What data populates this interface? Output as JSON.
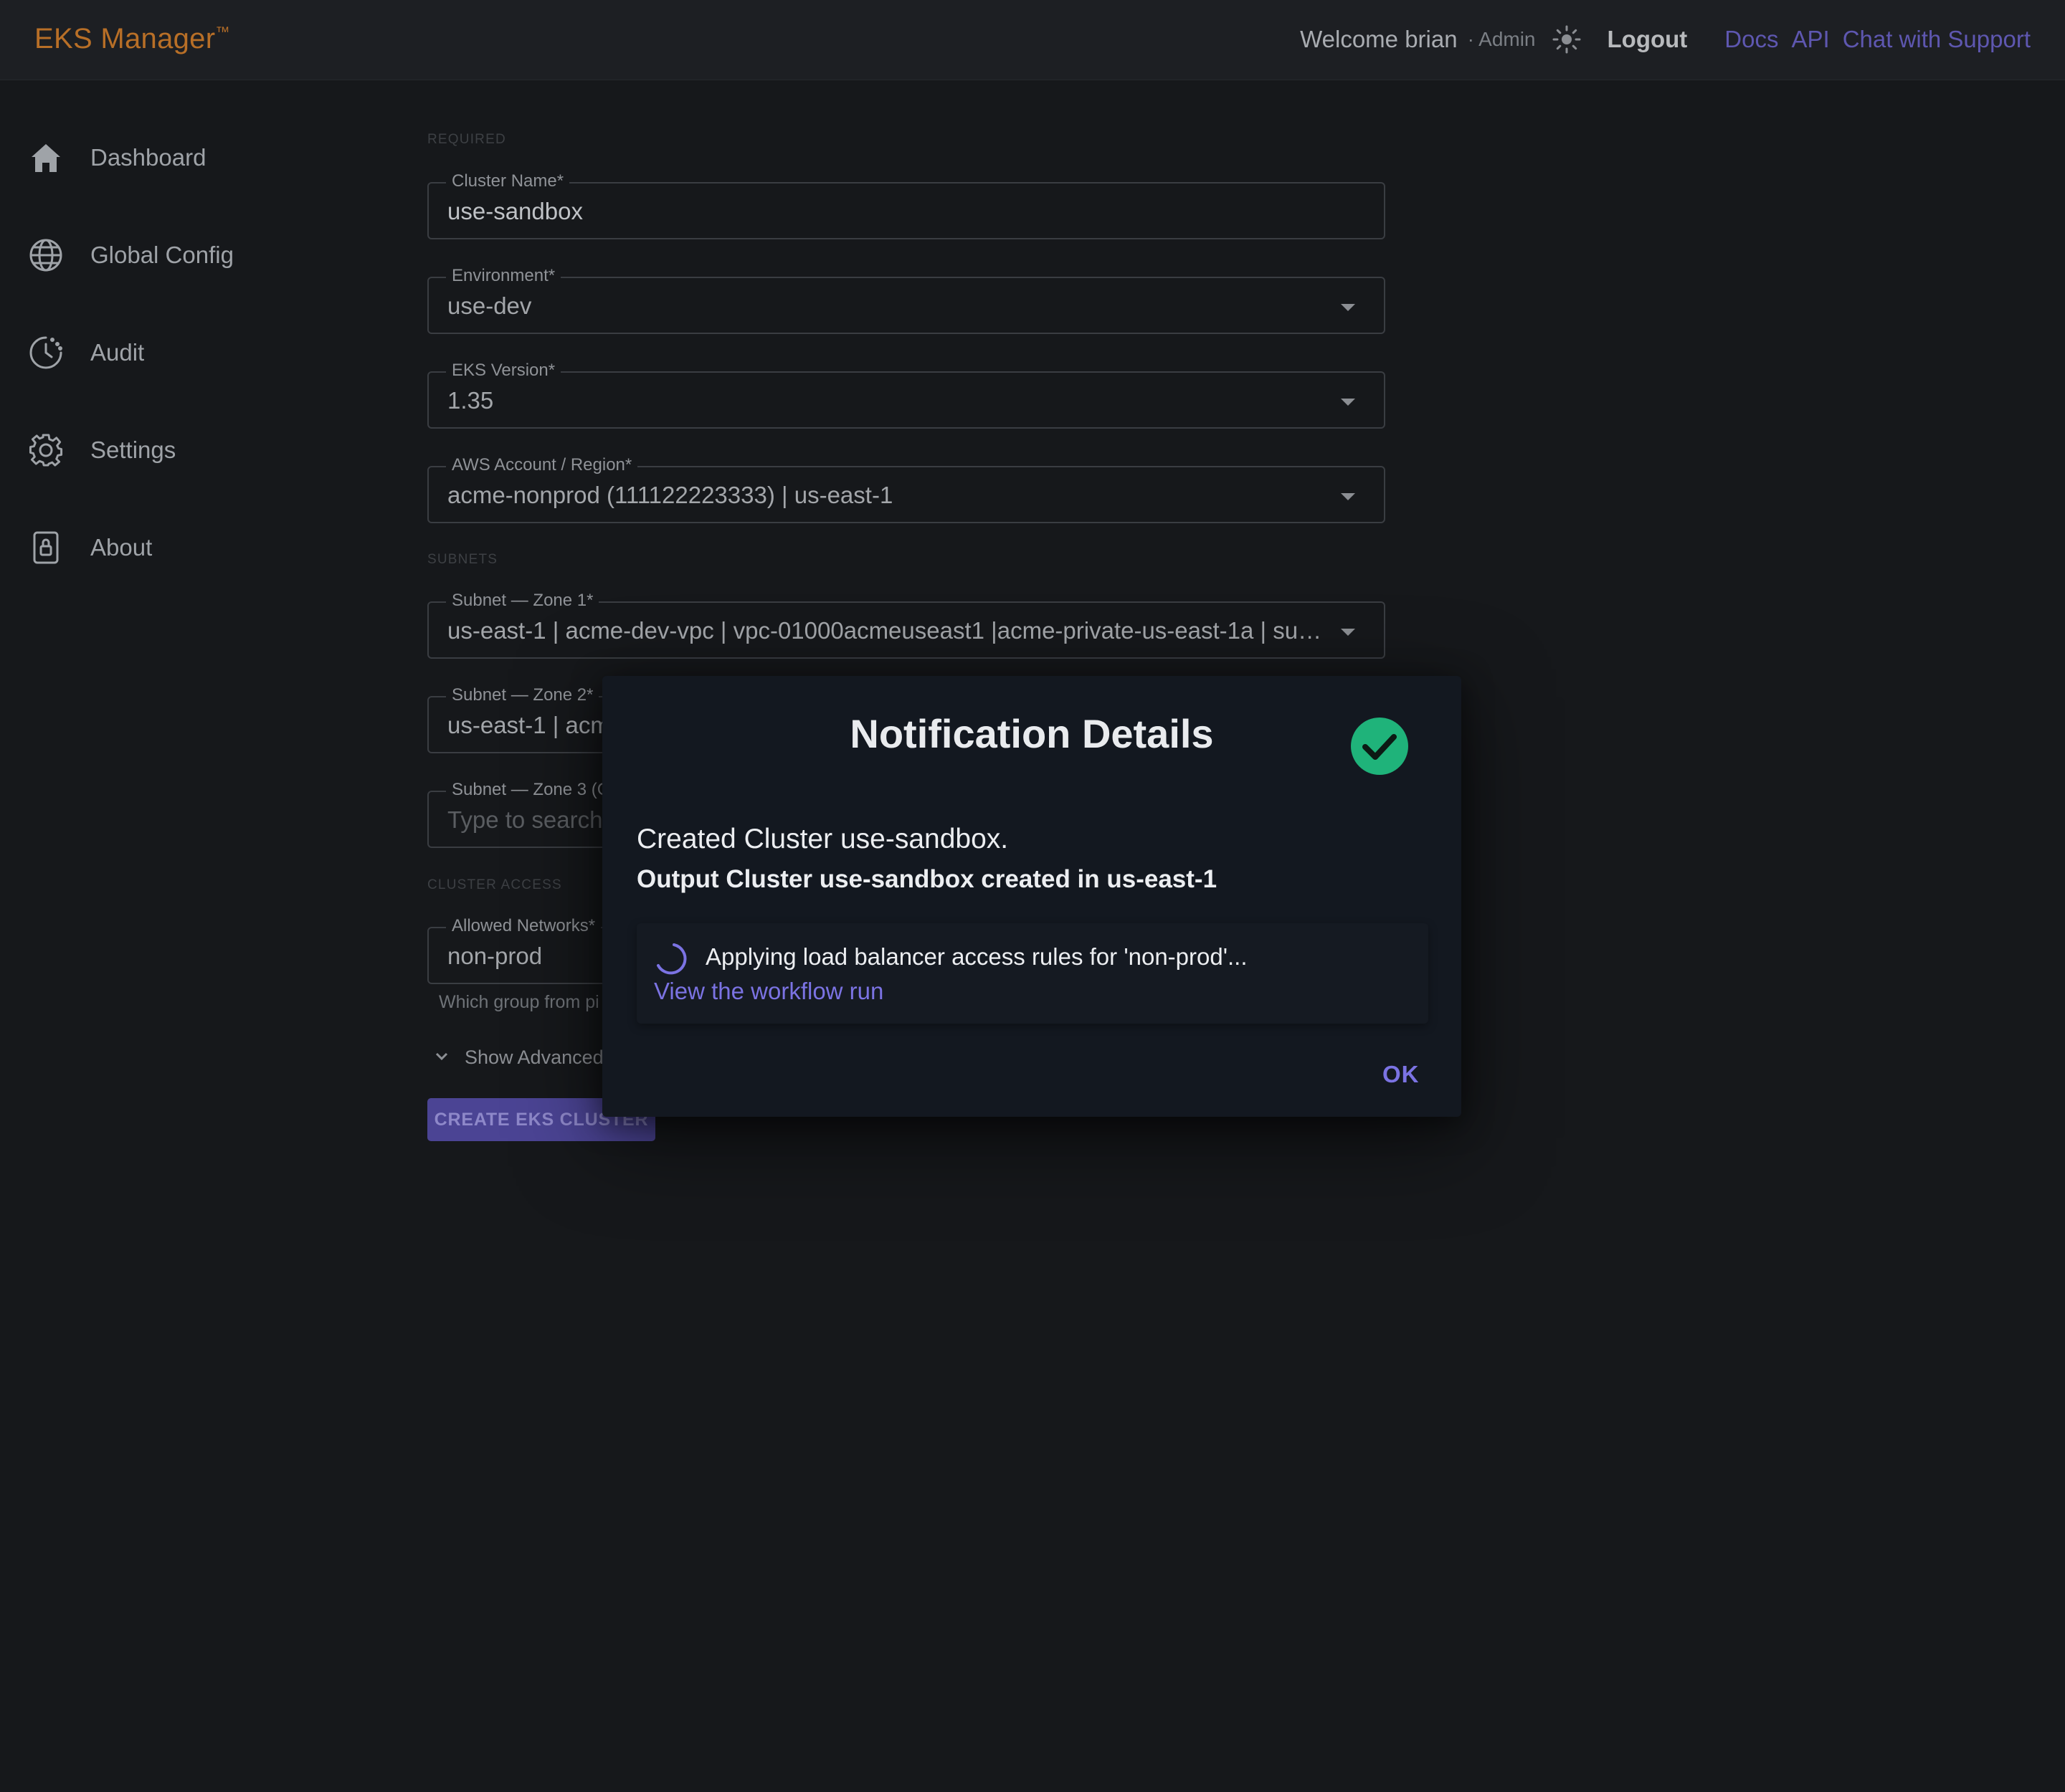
{
  "header": {
    "brand": "EKS Manager",
    "brand_mark": "™",
    "welcome": "Welcome brian",
    "role": "· Admin",
    "theme_icon": "sun-icon",
    "logout": "Logout",
    "links": [
      "Docs",
      "API",
      "Chat with Support"
    ]
  },
  "sidebar": {
    "items": [
      {
        "label": "Dashboard",
        "icon": "home-icon"
      },
      {
        "label": "Global Config",
        "icon": "globe-icon"
      },
      {
        "label": "Audit",
        "icon": "clock-icon"
      },
      {
        "label": "Settings",
        "icon": "gear-icon"
      },
      {
        "label": "About",
        "icon": "lock-icon"
      }
    ]
  },
  "form": {
    "sections": {
      "required": "REQUIRED",
      "subnets": "SUBNETS",
      "cluster_access": "CLUSTER ACCESS"
    },
    "cluster_name": {
      "label": "Cluster Name*",
      "value": "use-sandbox"
    },
    "environment": {
      "label": "Environment*",
      "value": "use-dev"
    },
    "eks_version": {
      "label": "EKS Version*",
      "value": "1.35"
    },
    "aws_account": {
      "label": "AWS Account / Region*",
      "value": "acme-nonprod (111122223333) | us-east-1"
    },
    "subnet_zone1": {
      "label": "Subnet — Zone 1*",
      "value": "us-east-1 | acme-dev-vpc | vpc-01000acmeuseast1 |acme-private-us-east-1a | subne..."
    },
    "subnet_zone2": {
      "label": "Subnet — Zone 2*",
      "value": "us-east-1 | acm"
    },
    "subnet_zone3": {
      "label": "Subnet — Zone 3 (C",
      "placeholder": "Type to search."
    },
    "allowed_networks": {
      "label": "Allowed Networks*",
      "value": "non-prod",
      "helper": "Which group from pi"
    },
    "show_advanced": "Show Advanced",
    "create_button": "CREATE EKS CLUSTER"
  },
  "modal": {
    "title": "Notification Details",
    "status_icon": "check-circle-icon",
    "status_color": "#1fb37a",
    "message": "Created Cluster use-sandbox.",
    "output": "Output Cluster use-sandbox created in us-east-1",
    "progress_text": "Applying load balancer access rules for 'non-prod'...",
    "workflow_link": "View the workflow run",
    "ok": "OK"
  },
  "colors": {
    "accent": "#7b73e3",
    "brand": "#b86f27",
    "link": "#5e57b0"
  }
}
